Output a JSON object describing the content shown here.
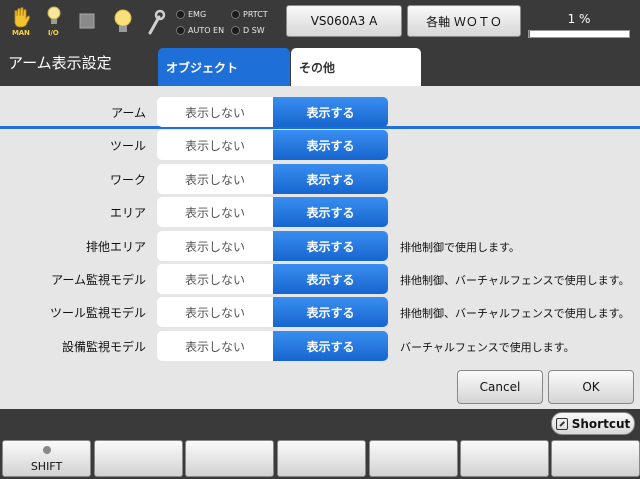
{
  "topbar": {
    "man_label": "MAN",
    "io_label": "I/O",
    "indicators": {
      "emg": "EMG",
      "prtct": "PRTCT",
      "auto_en": "AUTO EN",
      "dsw": "D SW"
    },
    "robot_button": "VS060A3 A",
    "axis_button": "各軸 ＷＯＴＯ",
    "speed_text": "1 %",
    "speed_percent": 1
  },
  "header": {
    "title": "アーム表示設定",
    "tabs": [
      {
        "label": "オブジェクト",
        "active": true
      },
      {
        "label": "その他",
        "active": false
      }
    ]
  },
  "options": {
    "off_label": "表示しない",
    "on_label": "表示する"
  },
  "rows": [
    {
      "label": "アーム",
      "note": ""
    },
    {
      "label": "ツール",
      "note": ""
    },
    {
      "label": "ワーク",
      "note": ""
    },
    {
      "label": "エリア",
      "note": ""
    },
    {
      "label": "排他エリア",
      "note": "排他制御で使用します。"
    },
    {
      "label": "アーム監視モデル",
      "note": "排他制御、バーチャルフェンスで使用します。"
    },
    {
      "label": "ツール監視モデル",
      "note": "排他制御、バーチャルフェンスで使用します。"
    },
    {
      "label": "設備監視モデル",
      "note": "バーチャルフェンスで使用します。"
    }
  ],
  "dialog": {
    "cancel": "Cancel",
    "ok": "OK"
  },
  "bottombar": {
    "shortcut": "Shortcut",
    "shift": "SHIFT"
  },
  "colors": {
    "accent": "#1f6fd8",
    "bar": "#3a3a3a"
  }
}
